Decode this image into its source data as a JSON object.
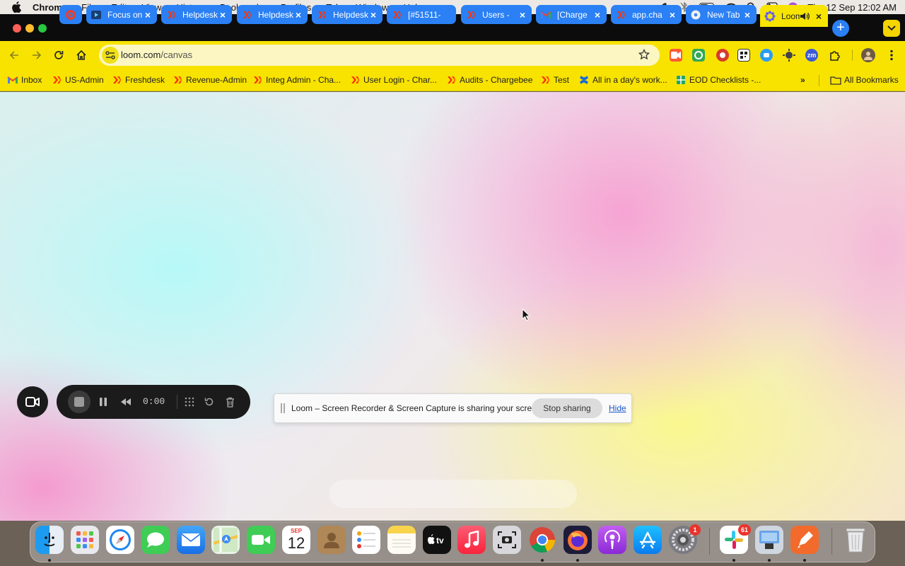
{
  "menubar": {
    "app_name": "Chrome",
    "menus": [
      "File",
      "Edit",
      "View",
      "History",
      "Bookmarks",
      "Profiles",
      "Tab",
      "Window",
      "Help"
    ],
    "clock": "Thu 12 Sep  12:02 AM"
  },
  "tabs": [
    {
      "title": "",
      "favicon": "loom-icon"
    },
    {
      "title": "Focus on",
      "favicon": "play-icon"
    },
    {
      "title": "Helpdesk",
      "favicon": "chargebee-icon"
    },
    {
      "title": "Helpdesk",
      "favicon": "chargebee-icon"
    },
    {
      "title": "Helpdesk",
      "favicon": "chargebee-icon"
    },
    {
      "title": "[#51511-",
      "favicon": "chargebee-icon"
    },
    {
      "title": "Users - ",
      "favicon": "chargebee-icon"
    },
    {
      "title": "[Charge",
      "favicon": "gmail-icon"
    },
    {
      "title": "app.cha",
      "favicon": "chargebee-icon"
    },
    {
      "title": "New Tab",
      "favicon": "chrome-icon"
    },
    {
      "title": "Loom",
      "favicon": "loom-icon",
      "active": true
    }
  ],
  "omnibox": {
    "host": "loom.com",
    "path": "/canvas"
  },
  "extensions_badge": "9+",
  "bookmarks": [
    {
      "label": "Inbox",
      "icon": "gmail-icon"
    },
    {
      "label": "US-Admin",
      "icon": "chargebee-icon"
    },
    {
      "label": "Freshdesk",
      "icon": "chargebee-icon"
    },
    {
      "label": "Revenue-Admin",
      "icon": "chargebee-icon"
    },
    {
      "label": "Integ Admin - Cha...",
      "icon": "chargebee-icon"
    },
    {
      "label": "User Login - Char...",
      "icon": "chargebee-icon"
    },
    {
      "label": "Audits - Chargebee",
      "icon": "chargebee-icon"
    },
    {
      "label": "Test",
      "icon": "chargebee-icon"
    },
    {
      "label": "All in a day's work...",
      "icon": "confluence-icon"
    },
    {
      "label": "EOD Checklists -...",
      "icon": "sheets-icon"
    }
  ],
  "all_bookmarks_label": "All Bookmarks",
  "loom": {
    "timer": "0:00"
  },
  "share_banner": {
    "message": "Loom – Screen Recorder & Screen Capture is sharing your screen.",
    "stop_label": "Stop sharing",
    "hide_label": "Hide"
  },
  "dock": {
    "calendar_month": "SEP",
    "calendar_day": "12",
    "system_settings_badge": "1",
    "slack_badge": "61"
  },
  "colors": {
    "tab_blue": "#2a80f4",
    "chrome_theme_yellow": "#f8e300",
    "chargebee_orange": "#ff3300"
  }
}
